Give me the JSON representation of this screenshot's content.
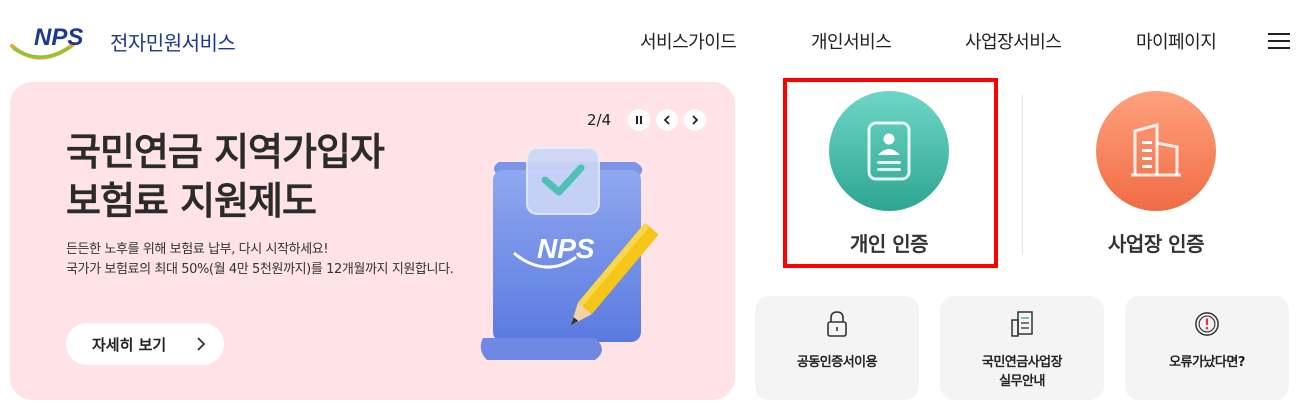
{
  "header": {
    "logo_text": "NPS",
    "service_name": "전자민원서비스",
    "nav": [
      "서비스가이드",
      "개인서비스",
      "사업장서비스",
      "마이페이지"
    ]
  },
  "banner": {
    "title_line1": "국민연금 지역가입자",
    "title_line2": "보험료 지원제도",
    "desc_line1": "든든한 노후를 위해 보험료 납부, 다시 시작하세요!",
    "desc_line2": "국가가 보험료의 최대 50%(월 4만 5천원까지)를 12개월까지 지원합니다.",
    "button_label": "자세히 보기",
    "pager": "2/4",
    "illustration_text": "NPS",
    "background_color": "#ffe3e6"
  },
  "auth": {
    "personal_label": "개인 인증",
    "business_label": "사업장 인증",
    "personal_color": "#3fb8a6",
    "business_color": "#f57e5a"
  },
  "cards": [
    {
      "label_line1": "공동인증서이용",
      "label_line2": "",
      "icon": "lock-icon"
    },
    {
      "label_line1": "국민연금사업장",
      "label_line2": "실무안내",
      "icon": "document-icon"
    },
    {
      "label_line1": "오류가났다면?",
      "label_line2": "",
      "icon": "alert-icon"
    }
  ],
  "colors": {
    "brand_navy": "#1d3a8a",
    "highlight": "#ff0000"
  }
}
